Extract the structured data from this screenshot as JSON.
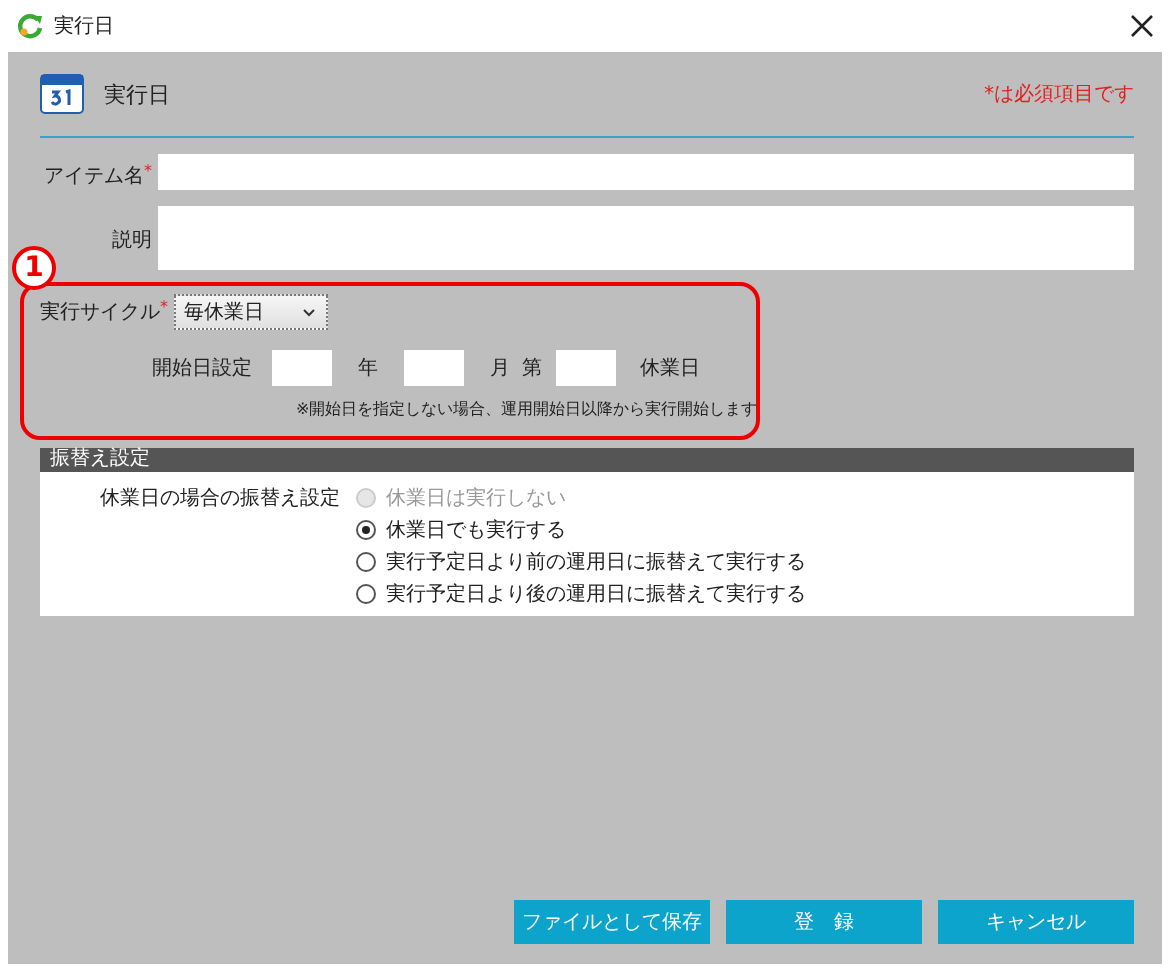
{
  "window": {
    "title": "実行日"
  },
  "header": {
    "title": "実行日",
    "required_note": "*は必須項目です"
  },
  "fields": [
    {
      "label": "アイテム名",
      "required_mark": "*",
      "kind": "text"
    },
    {
      "label": "説明",
      "kind": "textarea"
    }
  ],
  "cycle": {
    "label": "実行サイクル",
    "required_mark": "*",
    "value": "毎休業日"
  },
  "start_date": {
    "label": "開始日設定",
    "year_unit": "年",
    "month_unit": "月",
    "ordinal": "第",
    "day_unit": "休業日",
    "note": "※開始日を指定しない場合、運用開始日以降から実行開始します"
  },
  "annotation": {
    "label": "1"
  },
  "substitution": {
    "title": "振替え設定",
    "label": "休業日の場合の振替え設定",
    "options": [
      {
        "label": "休業日は実行しない",
        "selected": false,
        "disabled": true
      },
      {
        "label": "休業日でも実行する",
        "selected": true,
        "disabled": false
      },
      {
        "label": "実行予定日より前の運用日に振替えて実行する",
        "selected": false,
        "disabled": false
      },
      {
        "label": "実行予定日より後の運用日に振替えて実行する",
        "selected": false,
        "disabled": false
      }
    ]
  },
  "buttons": [
    "ファイルとして保存",
    "登　録",
    "キャンセル"
  ]
}
